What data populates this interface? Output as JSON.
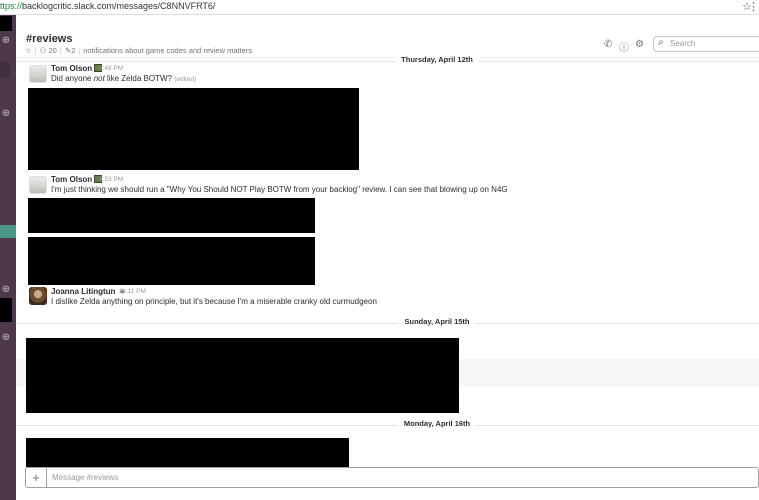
{
  "browser": {
    "url_scheme": "ttps://",
    "url_rest": "backlogcritic.slack.com/messages/C8NNVFRT6/",
    "star_icon": "star-icon",
    "menu_icon": "vertical-dots-icon"
  },
  "channel": {
    "name": "#reviews",
    "members": "20",
    "pins": "2",
    "topic": "notifications about game codes and review matters"
  },
  "header": {
    "search_placeholder": "Search"
  },
  "days": {
    "d1": "Thursday, April 12th",
    "d2": "Sunday, April 15th",
    "d3": "Monday, April 16th"
  },
  "messages": [
    {
      "sender": "Tom Olson",
      "time": "4:48 PM",
      "text_pre": "Did anyone ",
      "text_em": "not",
      "text_post": " like Zelda BOTW?",
      "edited": "(edited)"
    },
    {
      "sender": "Tom Olson",
      "time": "4:53 PM",
      "text": "I'm just thinking we should run a \"Why You Should NOT Play BOTW from your backlog\" review. I can see that blowing up on N4G"
    },
    {
      "sender": "Joanna Litingtun",
      "time": "11:11 PM",
      "text": "I dislike Zelda anything on principle, but it's because I'm a miserable cranky old curmudgeon"
    }
  ],
  "composer": {
    "placeholder": "Message #reviews"
  },
  "colors": {
    "sidebar": "#4d394b",
    "active_channel": "#4c9689",
    "text": "#2c2d30"
  }
}
